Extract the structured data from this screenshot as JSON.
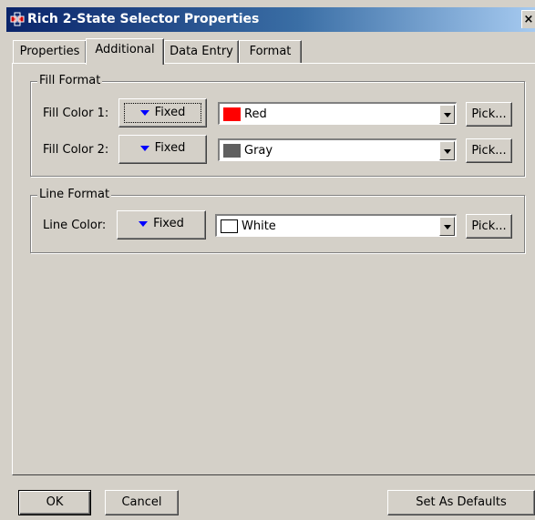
{
  "window": {
    "title": "Rich 2-State Selector Properties",
    "close_glyph": "×"
  },
  "tabs": [
    {
      "label": "Properties",
      "active": false
    },
    {
      "label": "Additional",
      "active": true
    },
    {
      "label": "Data Entry",
      "active": false
    },
    {
      "label": "Format",
      "active": false
    }
  ],
  "fill_format": {
    "legend": "Fill Format",
    "rows": [
      {
        "label": "Fill Color 1:",
        "mode": "Fixed",
        "color_name": "Red",
        "swatch": "#ff0000",
        "pick": "Pick..."
      },
      {
        "label": "Fill Color 2:",
        "mode": "Fixed",
        "color_name": "Gray",
        "swatch": "#606060",
        "pick": "Pick..."
      }
    ]
  },
  "line_format": {
    "legend": "Line Format",
    "rows": [
      {
        "label": "Line Color:",
        "mode": "Fixed",
        "color_name": "White",
        "swatch": "#ffffff",
        "pick": "Pick..."
      }
    ]
  },
  "footer": {
    "ok": "OK",
    "cancel": "Cancel",
    "set_defaults": "Set As Defaults"
  },
  "colors": {
    "titlebar_start": "#0a246a",
    "titlebar_end": "#a6caf0",
    "dialog_bg": "#d4d0c8",
    "mode_arrow": "#0000ff"
  }
}
